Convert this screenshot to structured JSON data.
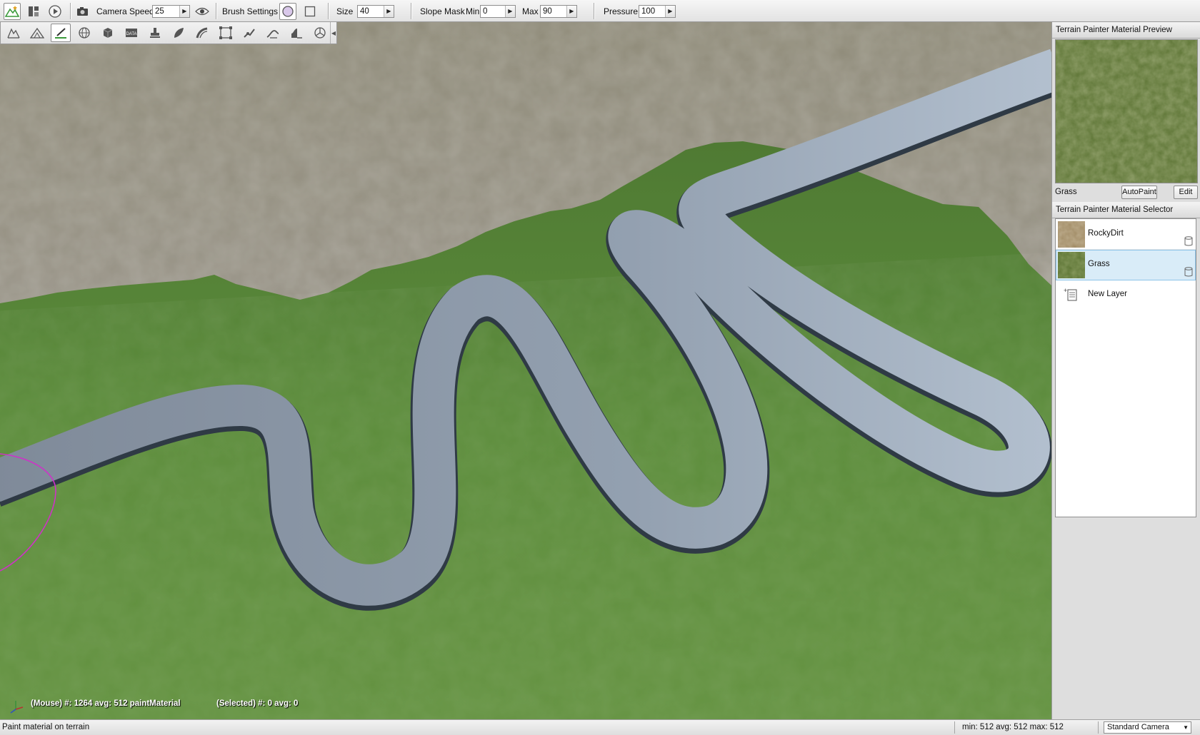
{
  "toolbar": {
    "camera_speed_label": "Camera Speed",
    "camera_speed_value": "25",
    "brush_settings_label": "Brush Settings",
    "size_label": "Size",
    "size_value": "40",
    "slope_mask_label": "Slope Mask",
    "min_label": "Min",
    "min_value": "0",
    "max_label": "Max",
    "max_value": "90",
    "pressure_label": "Pressure",
    "pressure_value": "100"
  },
  "palette": {
    "tools": [
      "select-object-icon",
      "raise-lower-height-icon",
      "paint-material-icon",
      "world-icon",
      "box-icon",
      "data-icon",
      "stamp-icon",
      "foliage-icon",
      "road-icon",
      "grid-transform-icon",
      "smooth-icon",
      "flatten-icon",
      "slope-icon",
      "noise-icon"
    ],
    "active_tool": "paint-material-icon"
  },
  "viewport": {
    "mouse_stat": "(Mouse) #: 1264  avg: 512 paintMaterial",
    "selected_stat": "(Selected) #: 0  avg: 0"
  },
  "preview_panel": {
    "title": "Terrain Painter Material Preview",
    "material_name": "Grass",
    "autopaint_label": "AutoPaint",
    "edit_label": "Edit"
  },
  "selector_panel": {
    "title": "Terrain Painter Material Selector",
    "materials": [
      {
        "name": "RockyDirt",
        "color": "#a08a64",
        "selected": false
      },
      {
        "name": "Grass",
        "color": "#5c7434",
        "selected": true
      }
    ],
    "new_layer_label": "New Layer"
  },
  "statusbar": {
    "message": "Paint material on terrain",
    "heights": "min: 512  avg: 512  max: 512",
    "camera": "Standard Camera"
  },
  "colors": {
    "grass": "#5b8a3c",
    "dirt": "#8a8576",
    "road": "#8d9bad",
    "brush_ring": "#d030c8",
    "selection": "#d9ecf8"
  }
}
